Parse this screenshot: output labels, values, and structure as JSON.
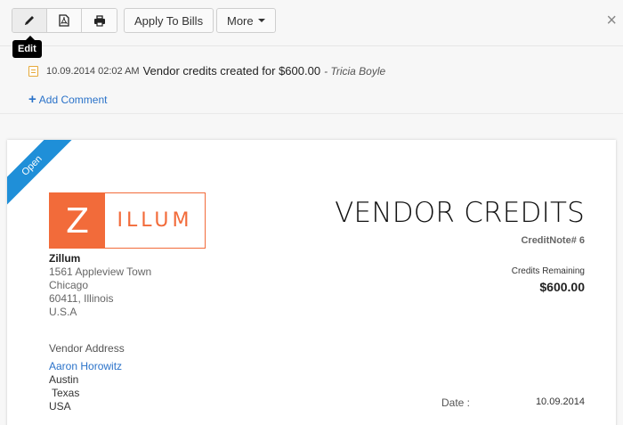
{
  "toolbar": {
    "icons": [
      "pencil-icon",
      "pdf-icon",
      "printer-icon"
    ],
    "apply_label": "Apply To Bills",
    "more_label": "More",
    "tooltip": "Edit",
    "close_symbol": "×"
  },
  "activity": {
    "timestamp": "10.09.2014 02:02 AM",
    "message": "Vendor credits created for $600.00",
    "author": "- Tricia Boyle",
    "add_comment": "Add Comment",
    "add_symbol": "+"
  },
  "document": {
    "status": "Open",
    "logo": {
      "letter": "Z",
      "text": "ILLUM"
    },
    "org": {
      "name": "Zillum",
      "address1": "1561 Appleview Town",
      "city": "Chicago",
      "zip_state": "60411, Illinois",
      "country": "U.S.A"
    },
    "title": "VENDOR CREDITS",
    "credit_note": "CreditNote# 6",
    "credits_label": "Credits Remaining",
    "credits_value": "$600.00",
    "vendor_heading": "Vendor Address",
    "vendor": {
      "name": "Aaron Horowitz",
      "city": "Austin",
      "state": "Texas",
      "country": "USA"
    },
    "date_label": "Date :",
    "date_value": "10.09.2014"
  },
  "colors": {
    "accent": "#2a72c9",
    "brand": "#f26b3a",
    "ribbon": "#1f8fd8"
  }
}
